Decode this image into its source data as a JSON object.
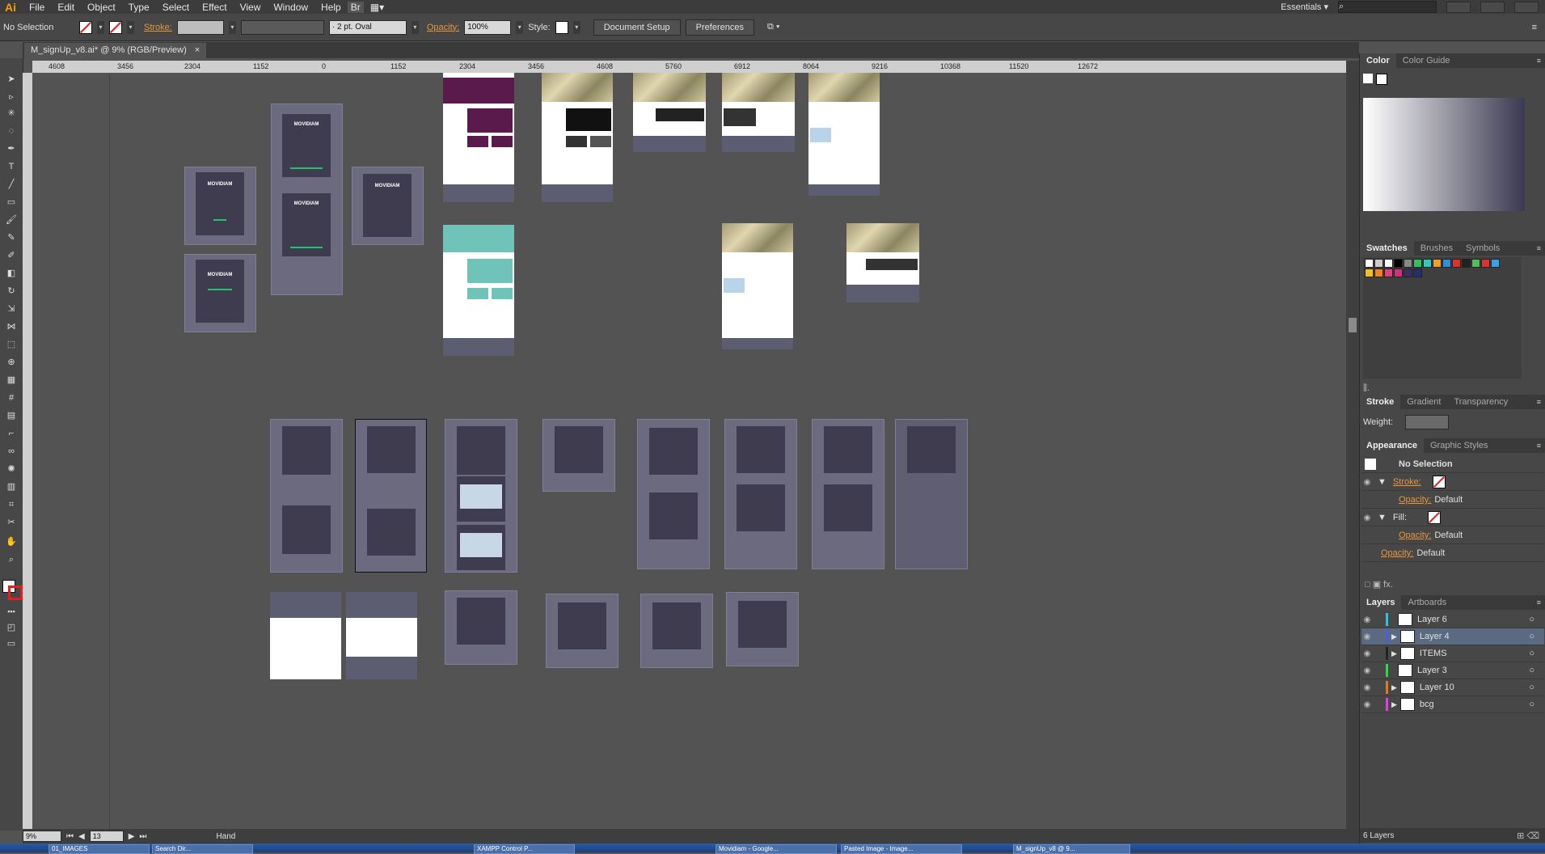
{
  "app": {
    "logo": "Ai",
    "workspace": "Essentials ▾"
  },
  "menu": [
    "File",
    "Edit",
    "Object",
    "Type",
    "Select",
    "Effect",
    "View",
    "Window",
    "Help"
  ],
  "control": {
    "selection": "No Selection",
    "stroke_label": "Stroke:",
    "brush": "·  2 pt. Oval",
    "opacity_label": "Opacity:",
    "opacity_value": "100%",
    "style_label": "Style:",
    "document_setup": "Document Setup",
    "preferences": "Preferences"
  },
  "document": {
    "tab_title": "M_signUp_v8.ai* @ 9% (RGB/Preview)",
    "close": "×"
  },
  "ruler": {
    "h_ticks": [
      "4608",
      "3456",
      "2304",
      "1152",
      "0",
      "1152",
      "2304",
      "3456",
      "4608",
      "5760",
      "6912",
      "8064",
      "9216",
      "10368",
      "11520",
      "12672"
    ]
  },
  "status": {
    "zoom": "9%",
    "artboard": "13",
    "tool": "Hand"
  },
  "panels": {
    "color": {
      "tabs": [
        "Color",
        "Color Guide"
      ]
    },
    "swatches": {
      "tabs": [
        "Swatches",
        "Brushes",
        "Symbols"
      ]
    },
    "stroke": {
      "tabs": [
        "Stroke",
        "Gradient",
        "Transparency"
      ],
      "weight_label": "Weight:"
    },
    "appearance": {
      "tabs": [
        "Appearance",
        "Graphic Styles"
      ],
      "title": "No Selection",
      "stroke_label": "Stroke:",
      "opacity_label": "Opacity:",
      "opacity_value": "Default",
      "fill_label": "Fill:",
      "opacity2_label": "Opacity:",
      "opacity2_value": "Default",
      "opacity3_label": "Opacity:",
      "opacity3_value": "Default"
    },
    "layers": {
      "tabs": [
        "Layers",
        "Artboards"
      ],
      "items": [
        {
          "name": "Layer 6",
          "color": "#2fc3e0"
        },
        {
          "name": "Layer 4",
          "color": "#4a5ee0"
        },
        {
          "name": "ITEMS",
          "color": "#222222"
        },
        {
          "name": "Layer 3",
          "color": "#38d44a"
        },
        {
          "name": "Layer 10",
          "color": "#e07a20"
        },
        {
          "name": "bcg",
          "color": "#e040e0"
        }
      ],
      "count": "6 Layers"
    }
  },
  "taskbar": [
    "01_IMAGES",
    "Search Dir...",
    "XAMPP Control P...",
    "Movidiam - Google...",
    "Pasted Image - Image...",
    "M_signUp_v8 @ 9..."
  ],
  "mock": {
    "brand": "MOVIDIAM"
  },
  "colors": {
    "accent": "#e8963a",
    "canvas": "#535353",
    "artboard": "#6b6a7f"
  }
}
